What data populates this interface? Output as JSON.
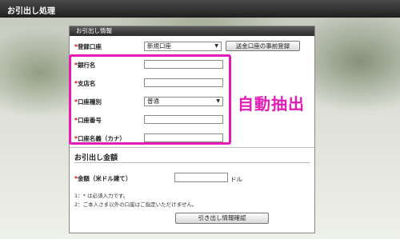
{
  "title": "お引出し処理",
  "section1": {
    "header": "お引出し情報",
    "registered_account": {
      "label": "登録口座",
      "selected": "新規口座",
      "button": "送金口座の事前登録"
    },
    "bank_name_label": "銀行名",
    "branch_label": "支店名",
    "account_type": {
      "label": "口座種別",
      "selected": "普通"
    },
    "account_number_label": "口座番号",
    "account_holder_label": "口座名義（カナ）"
  },
  "overlay": {
    "auto_extract": "自動抽出"
  },
  "section2": {
    "header": "お引出し金額",
    "amount_label": "金額（米ドル建て）",
    "unit": "ドル",
    "note1": "1：* は必須入力です。",
    "note2": "2：ご本人さま以外の口座はご指定いただけません。",
    "submit": "引き出し情報確認"
  },
  "colors": {
    "highlight": "#e51bb8",
    "required": "#d60000"
  }
}
